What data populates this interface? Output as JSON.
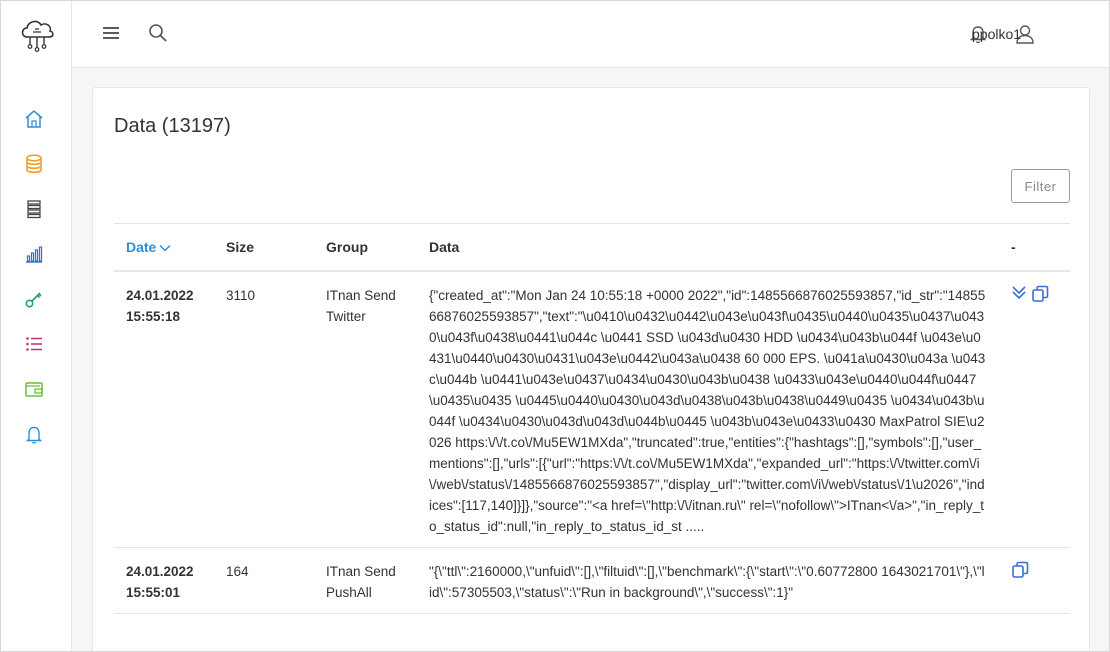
{
  "user": {
    "name": "ppolko1"
  },
  "page": {
    "title": "Data (13197)",
    "filter_label": "Filter"
  },
  "table": {
    "headers": {
      "date": "Date",
      "size": "Size",
      "group": "Group",
      "data": "Data",
      "actions": "-"
    },
    "rows": [
      {
        "date": "24.01.2022",
        "time": "15:55:18",
        "size": "3110",
        "group_line1": "ITnan Send",
        "group_line2": "Twitter",
        "data": "{\"created_at\":\"Mon Jan 24 10:55:18 +0000 2022\",\"id\":1485566876025593857,\"id_str\":\"1485566876025593857\",\"text\":\"\\u0410\\u0432\\u0442\\u043e\\u043f\\u0435\\u0440\\u0435\\u0437\\u0430\\u043f\\u0438\\u0441\\u044c \\u0441 SSD \\u043d\\u0430 HDD \\u0434\\u043b\\u044f \\u043e\\u0431\\u0440\\u0430\\u0431\\u043e\\u0442\\u043a\\u0438 60 000 EPS. \\u041a\\u0430\\u043a \\u043c\\u044b \\u0441\\u043e\\u0437\\u0434\\u0430\\u043b\\u0438 \\u0433\\u043e\\u0440\\u044f\\u0447\\u0435\\u0435 \\u0445\\u0440\\u0430\\u043d\\u0438\\u043b\\u0438\\u0449\\u0435 \\u0434\\u043b\\u044f \\u0434\\u0430\\u043d\\u043d\\u044b\\u0445 \\u043b\\u043e\\u0433\\u0430 MaxPatrol SIE\\u2026 https:\\/\\/t.co\\/Mu5EW1MXda\",\"truncated\":true,\"entities\":{\"hashtags\":[],\"symbols\":[],\"user_mentions\":[],\"urls\":[{\"url\":\"https:\\/\\/t.co\\/Mu5EW1MXda\",\"expanded_url\":\"https:\\/\\/twitter.com\\/i\\/web\\/status\\/1485566876025593857\",\"display_url\":\"twitter.com\\/i\\/web\\/status\\/1\\u2026\",\"indices\":[117,140]}]},\"source\":\"<a href=\\\"http:\\/\\/itnan.ru\\\" rel=\\\"nofollow\\\">ITnan<\\/a>\",\"in_reply_to_status_id\":null,\"in_reply_to_status_id_st .....",
        "expandable": true
      },
      {
        "date": "24.01.2022",
        "time": "15:55:01",
        "size": "164",
        "group_line1": "ITnan Send",
        "group_line2": "PushAll",
        "data": "\"{\\\"ttl\\\":2160000,\\\"unfuid\\\":[],\\\"filtuid\\\":[],\\\"benchmark\\\":{\\\"start\\\":\\\"0.60772800 1643021701\\\"},\\\"lid\\\":57305503,\\\"status\\\":\\\"Run in background\\\",\\\"success\\\":1}\"",
        "expandable": false
      }
    ]
  },
  "colors": {
    "accent": "#2f8fd6",
    "action": "#3c6fd1"
  }
}
